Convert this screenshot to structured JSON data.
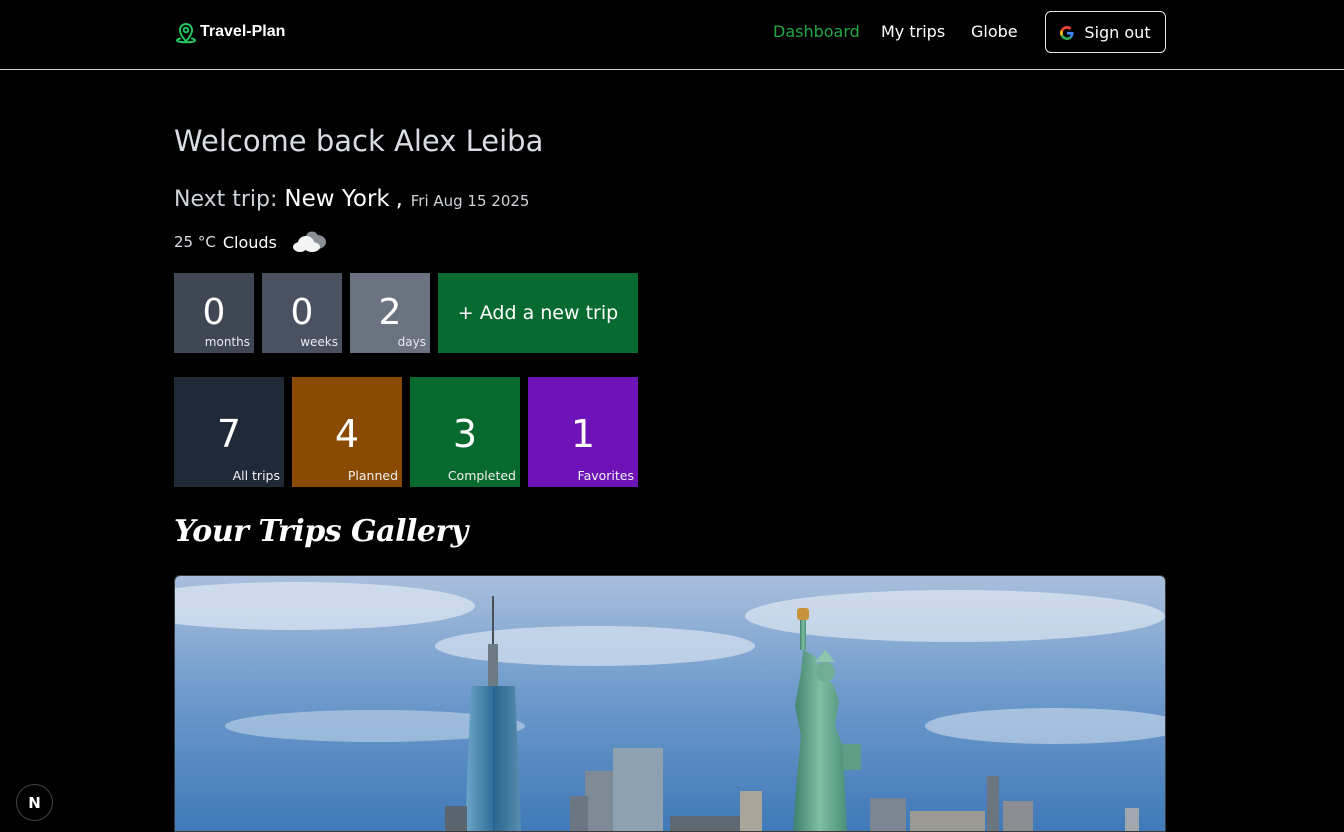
{
  "navbar": {
    "brand": "Travel-Plan",
    "links": {
      "dashboard": "Dashboard",
      "my_trips": "My trips",
      "globe": "Globe"
    },
    "sign_out": "Sign out",
    "active_color": "#22a845"
  },
  "welcome": {
    "text": "Welcome back Alex Leiba"
  },
  "next_trip": {
    "label": "Next trip:",
    "city": "New York",
    "comma": ",",
    "date": "Fri Aug 15 2025"
  },
  "weather": {
    "temp": "25 °C",
    "condition": "Clouds",
    "icon": "cloud-icon"
  },
  "countdown": [
    {
      "value": "0",
      "unit": "months"
    },
    {
      "value": "0",
      "unit": "weeks"
    },
    {
      "value": "2",
      "unit": "days"
    }
  ],
  "add_trip_label": "+ Add a new trip",
  "stats": [
    {
      "value": "7",
      "label": "All trips",
      "color": "#1f2937"
    },
    {
      "value": "4",
      "label": "Planned",
      "color": "#8a4a02"
    },
    {
      "value": "3",
      "label": "Completed",
      "color": "#066a2f"
    },
    {
      "value": "1",
      "label": "Favorites",
      "color": "#6d13b7"
    }
  ],
  "gallery": {
    "title": "Your Trips Gallery"
  },
  "dev_badge": "N"
}
